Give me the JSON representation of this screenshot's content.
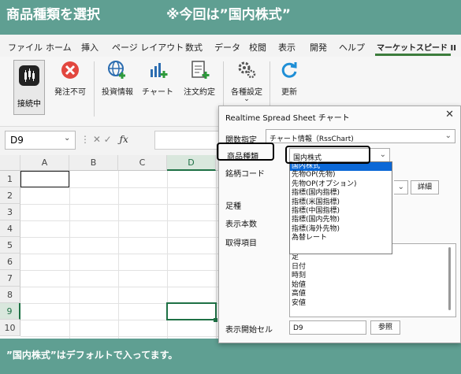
{
  "banner": {
    "title_left": "商品種類を選択",
    "title_right": "※今回は”国内株式”"
  },
  "menu": {
    "items": [
      "ファイル",
      "ホーム",
      "挿入",
      "ページ レイアウト",
      "数式",
      "データ",
      "校閲",
      "表示",
      "開発",
      "ヘルプ",
      "マーケットスピード II"
    ]
  },
  "ribbon": {
    "connect": "接続中",
    "stop_order": "発注不可",
    "invest_info": "投資情報",
    "chart": "チャート",
    "order_confirm": "注文約定",
    "settings": "各種設定",
    "settings_chevron": "⌄",
    "refresh": "更新"
  },
  "formula": {
    "cell_ref": "D9",
    "fx": "ƒx",
    "icons": "⋮  ✕  ✓"
  },
  "sheet": {
    "columns": [
      "A",
      "B",
      "C",
      "D"
    ],
    "rows": [
      "1",
      "2",
      "3",
      "4",
      "5",
      "6",
      "7",
      "8",
      "9",
      "10"
    ]
  },
  "dialog": {
    "title": "Realtime Spread Sheet チャート",
    "close": "✕",
    "func_label": "関数指定",
    "func_value": "チャート情報（RssChart)",
    "product_label": "商品種類",
    "product_value": "国内株式",
    "code_label": "銘柄コード",
    "detail_button": "詳細",
    "leg_label": "足種",
    "count_label": "表示本数",
    "items_label": "取得項目",
    "start_cell_label": "表示開始セル",
    "start_cell_value": "D9",
    "ref_button": "参照",
    "product_options": [
      "国内株式",
      "先物OP(先物)",
      "先物OP(オプション)",
      "指標(国内指標)",
      "指標(米国指標)",
      "指標(中国指標)",
      "指標(国内先物)",
      "指標(海外先物)",
      "為替レート"
    ],
    "item_list": [
      "足",
      "日付",
      "時刻",
      "始値",
      "高値",
      "安値"
    ]
  },
  "footer": {
    "note": "”国内株式”はデフォルトで入ってます。"
  },
  "colors": {
    "frame": "#5f9f92",
    "selected_option": "#0b68d7",
    "cell_selection": "#1e7145"
  }
}
